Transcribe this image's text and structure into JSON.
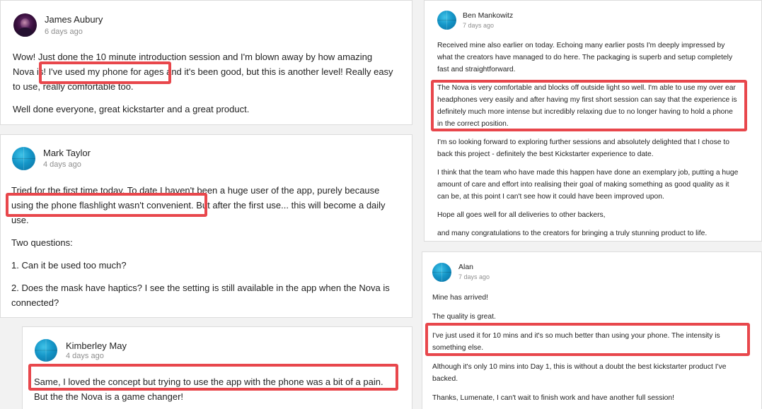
{
  "colors": {
    "highlight": "#e8474c",
    "timestamp": "#8f8f8f",
    "card_border": "#dcdcdc"
  },
  "comments": {
    "james": {
      "name": "James Aubury",
      "time": "6 days ago",
      "lines": [
        "Wow!  Just done the 10 minute introduction session and I'm blown away by how amazing",
        "Nova is! I've used my phone for ages and it's been good, but this is another level! Really easy",
        "to use, really comfortable too.",
        "Well done everyone, great kickstarter and a great product."
      ]
    },
    "mark": {
      "name": "Mark Taylor",
      "time": "4 days ago",
      "lines": [
        "Tried for the first time today. To date I haven't been a huge user of the app, purely because",
        "using the phone flashlight wasn't convenient.  But after the first use... this will become a daily",
        "use.",
        "Two questions:",
        "1. Can it be used too much?",
        "2. Does the mask have haptics? I see the setting is still available in the app when the Nova is",
        "connected?"
      ]
    },
    "kimberley": {
      "name": "Kimberley May",
      "time": "4 days ago",
      "lines": [
        "Same, I loved the concept but trying to use the app with the phone was a bit of a pain.",
        "But the the Nova is a game changer!"
      ]
    },
    "ben": {
      "name": "Ben Mankowitz",
      "time": "7 days ago",
      "lines": [
        "Received mine also earlier on today. Echoing many earlier posts I'm deeply impressed by",
        "what the creators have managed to do here. The packaging is superb and setup completely",
        "fast and straightforward.",
        "The Nova is very comfortable and blocks off outside light so well. I'm able to use my over ear",
        "headphones very easily and after having my first short session can say that the experience is",
        "definitely much more intense but incredibly relaxing due to no longer having to hold a phone",
        "in the correct position.",
        "I'm so looking forward to exploring further sessions and absolutely delighted that I chose to",
        "back this project - definitely the best Kickstarter experience to date.",
        "I think that the team who have made this happen have done an exemplary job, putting a huge",
        "amount of care and effort into realising their goal of making something as good quality as it",
        "can be, at this point I can't see how it could have been improved upon.",
        "Hope all goes well for all deliveries to other backers,",
        "and many congratulations to the creators for bringing a truly stunning product to life."
      ]
    },
    "alan": {
      "name": "Alan",
      "time": "7 days ago",
      "lines": [
        "Mine has arrived!",
        "The quality is great.",
        "I've just used it for 10 mins and it's so much better than using your phone. The intensity is",
        "something else.",
        "Although it's only 10 mins into Day 1, this is without a doubt the best kickstarter product I've",
        "backed.",
        "Thanks, Lumenate, I can't wait to finish work and have another full session!"
      ]
    }
  }
}
